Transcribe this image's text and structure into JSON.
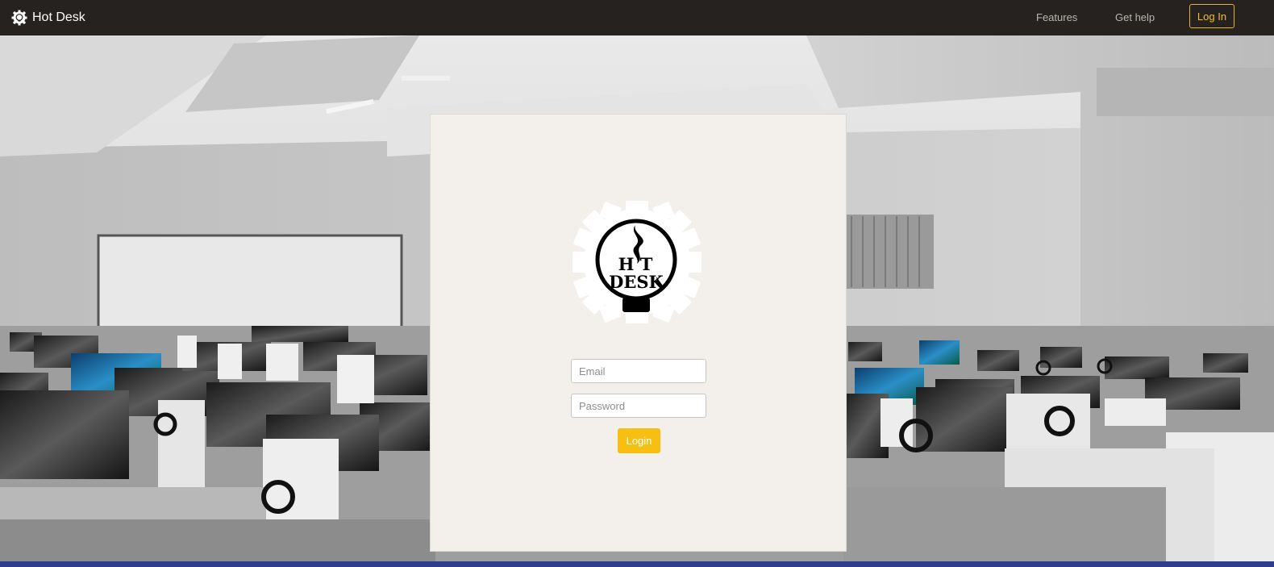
{
  "navbar": {
    "brand": {
      "icon": "gear-bulb-icon",
      "title": "Hot Desk"
    },
    "links": {
      "features": "Features",
      "help": "Get help"
    },
    "login_button": "Log In",
    "colors": {
      "background": "#25221f",
      "accent": "#f3bd2a"
    }
  },
  "login_card": {
    "logo": {
      "icon": "hot-desk-logo",
      "line1": "H T",
      "line2": "DESK"
    },
    "email": {
      "placeholder": "Email",
      "value": ""
    },
    "password": {
      "placeholder": "Password",
      "value": ""
    },
    "submit_label": "Login",
    "colors": {
      "card": "#f3efeb",
      "button": "#f7bf12"
    }
  },
  "background": {
    "description_icon": "computer-lab-photo"
  }
}
